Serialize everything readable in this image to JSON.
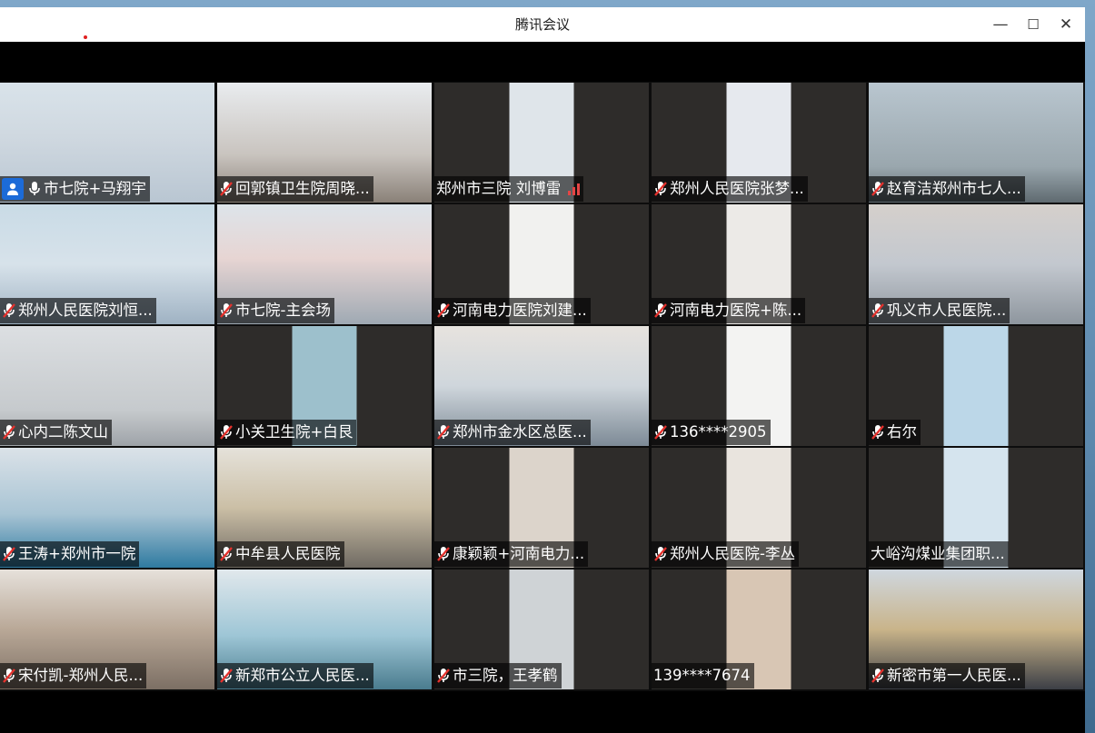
{
  "window": {
    "title": "腾讯会议",
    "controls": {
      "minimize": "—",
      "maximize": "☐",
      "close": "✕"
    }
  },
  "participants": [
    {
      "name": "市七院+马翔宇",
      "mic": "on",
      "host": true
    },
    {
      "name": "回郭镇卫生院周晓...",
      "mic": "muted"
    },
    {
      "name": "郑州市三院 刘博雷",
      "mic": "none",
      "signal": true
    },
    {
      "name": "郑州人民医院张梦...",
      "mic": "muted"
    },
    {
      "name": "赵育洁郑州市七人...",
      "mic": "muted"
    },
    {
      "name": "郑州人民医院刘恒...",
      "mic": "muted"
    },
    {
      "name": "市七院-主会场",
      "mic": "muted"
    },
    {
      "name": "河南电力医院刘建...",
      "mic": "muted"
    },
    {
      "name": "河南电力医院+陈...",
      "mic": "muted"
    },
    {
      "name": "巩义市人民医院...",
      "mic": "muted"
    },
    {
      "name": "心内二陈文山",
      "mic": "muted"
    },
    {
      "name": "小关卫生院+白艮",
      "mic": "muted"
    },
    {
      "name": "郑州市金水区总医...",
      "mic": "muted"
    },
    {
      "name": "136****2905",
      "mic": "muted"
    },
    {
      "name": "右尔",
      "mic": "muted"
    },
    {
      "name": "王涛+郑州市一院",
      "mic": "muted"
    },
    {
      "name": "中牟县人民医院",
      "mic": "muted"
    },
    {
      "name": "康颖颖+河南电力...",
      "mic": "muted"
    },
    {
      "name": "郑州人民医院-李丛",
      "mic": "muted"
    },
    {
      "name": "大峪沟煤业集团职...",
      "mic": "none"
    },
    {
      "name": "宋付凯-郑州人民...",
      "mic": "muted"
    },
    {
      "name": "新郑市公立人民医...",
      "mic": "muted"
    },
    {
      "name": "市三院，王孝鹤",
      "mic": "muted"
    },
    {
      "name": "139****7674",
      "mic": "none"
    },
    {
      "name": "新密市第一人民医...",
      "mic": "muted"
    }
  ],
  "colors": {
    "mic_muted": "#e5322d",
    "host_badge": "#1c6bd8",
    "signal": "#e54545"
  }
}
